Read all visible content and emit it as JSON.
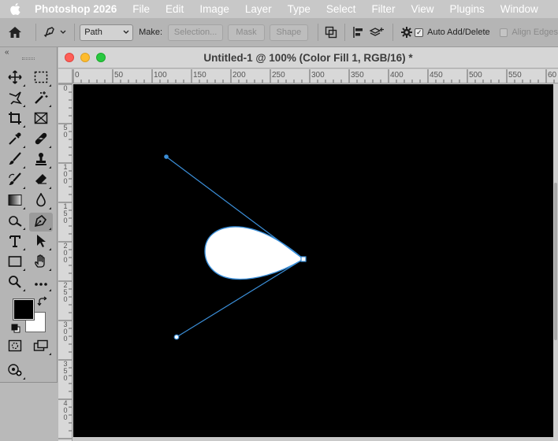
{
  "menubar": {
    "app_name": "Photoshop 2026",
    "items": [
      "File",
      "Edit",
      "Image",
      "Layer",
      "Type",
      "Select",
      "Filter",
      "View",
      "Plugins",
      "Window"
    ]
  },
  "options": {
    "mode_value": "Path",
    "make_label": "Make:",
    "selection_label": "Selection...",
    "mask_label": "Mask",
    "shape_label": "Shape",
    "auto_add_delete_label": "Auto Add/Delete",
    "auto_add_delete_checked": true,
    "align_edges_label": "Align Edges"
  },
  "document": {
    "title": "Untitled-1 @ 100% (Color Fill 1, RGB/16) *",
    "ruler_h_labels": [
      "0",
      "50",
      "100",
      "150",
      "200",
      "250",
      "300",
      "350",
      "400",
      "450",
      "500",
      "550",
      "60"
    ],
    "ruler_v_labels": [
      [
        "0"
      ],
      [
        "5",
        "0"
      ],
      [
        "1",
        "0",
        "0"
      ],
      [
        "1",
        "5",
        "0"
      ],
      [
        "2",
        "0",
        "0"
      ],
      [
        "2",
        "5",
        "0"
      ],
      [
        "3",
        "0",
        "0"
      ],
      [
        "3",
        "5",
        "0"
      ],
      [
        "4",
        "0",
        "0"
      ]
    ],
    "canvas_color": "#000000",
    "path_color": "#3b8fd9"
  },
  "tools": {
    "foreground_color": "#000000",
    "background_color": "#ffffff",
    "active_tool": "pen-tool"
  }
}
